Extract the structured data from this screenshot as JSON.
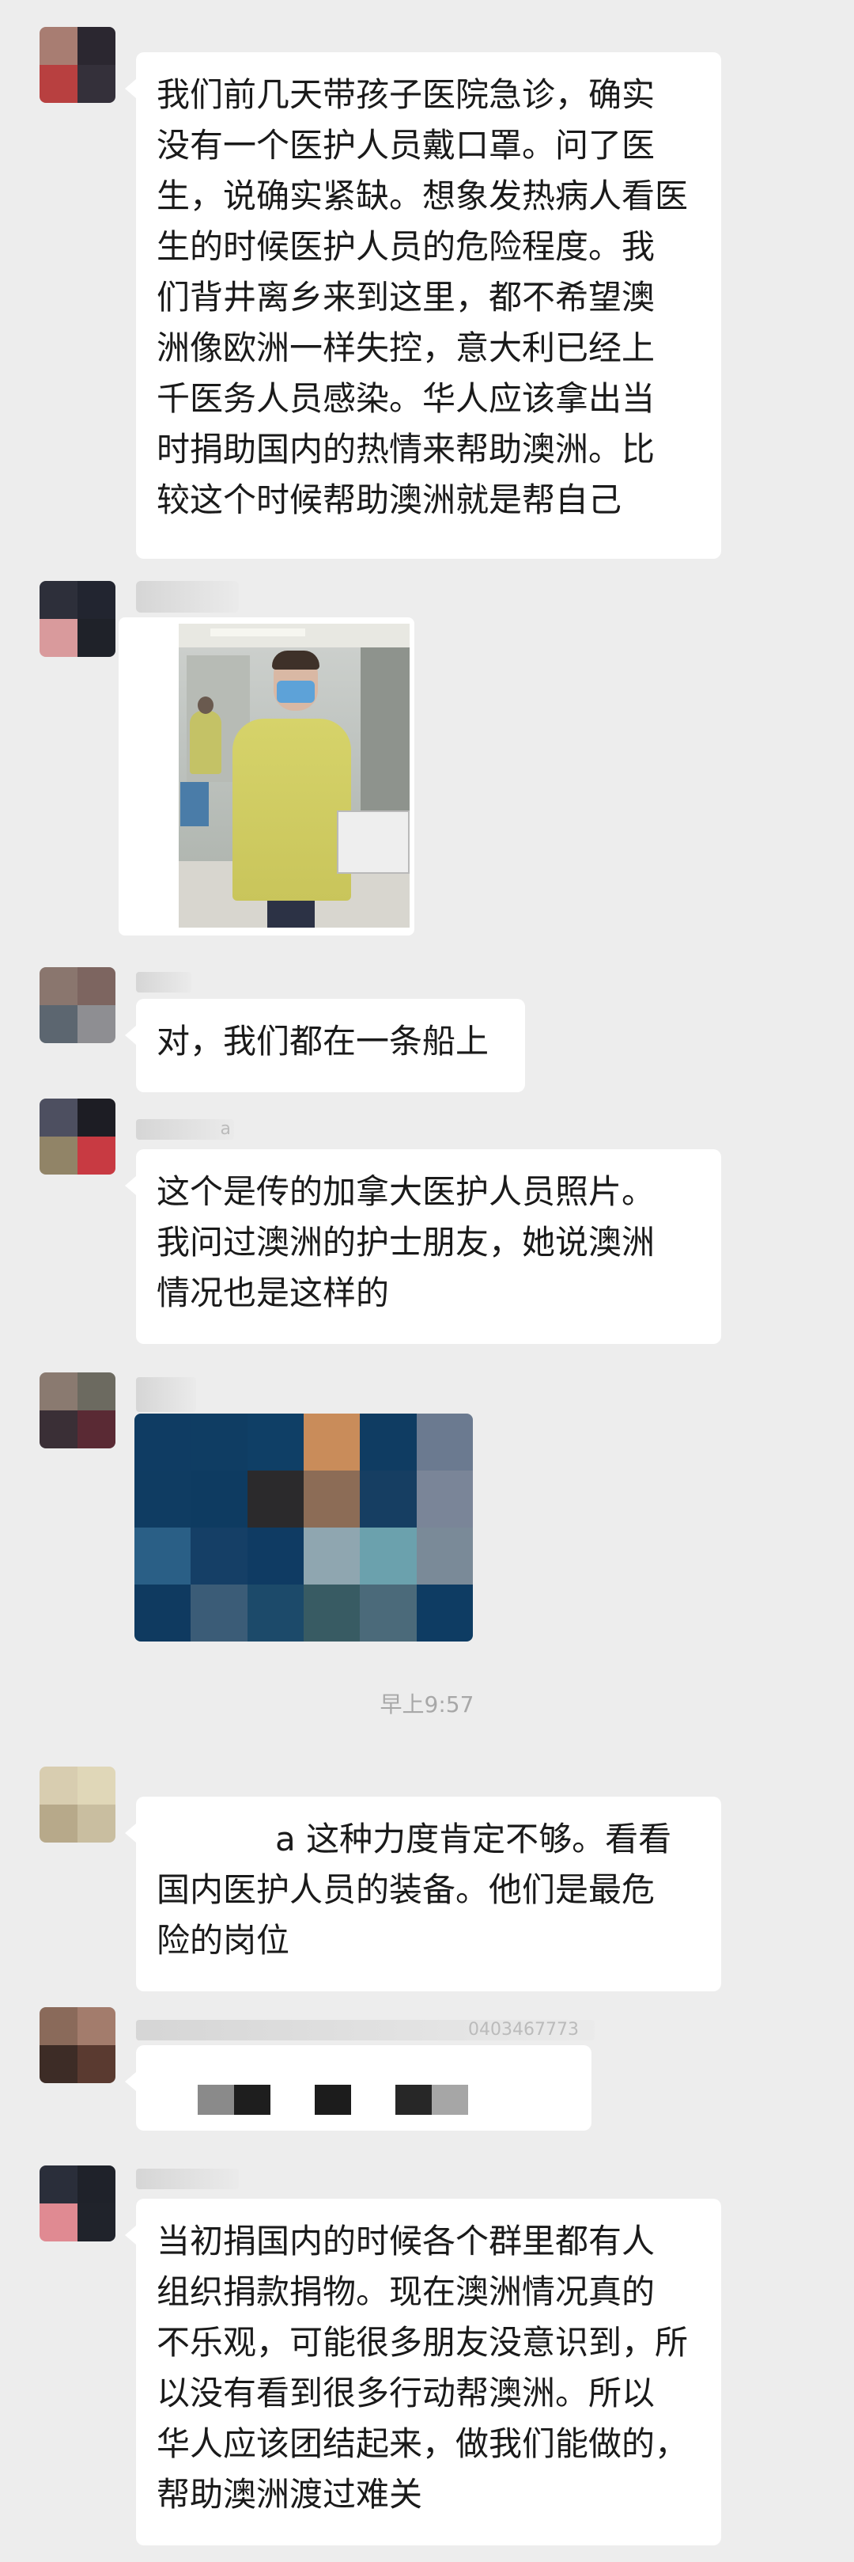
{
  "messages": [
    {
      "lines": [
        "我们前几天带孩子医院急诊，确实",
        "没有一个医护人员戴口罩。问了医",
        "生，说确实紧缺。想象发热病人看医",
        "生的时候医护人员的危险程度。我",
        "们背井离乡来到这里，都不希望澳",
        "洲像欧洲一样失控，意大利已经上",
        "千医务人员感染。华人应该拿出当",
        "时捐助国内的热情来帮助澳洲。比",
        "较这个时候帮助澳洲就是帮自己"
      ]
    },
    {
      "lines": [
        "对，我们都在一条船上"
      ]
    },
    {
      "lines": [
        "这个是传的加拿大医护人员照片。",
        "我问过澳洲的护士朋友，她说澳洲",
        "情况也是这样的"
      ]
    },
    {
      "lines": [
        "a 这种力度肯定不够。看看",
        "国内医护人员的装备。他们是最危",
        "险的岗位"
      ]
    },
    {
      "lines": [
        "当初捐国内的时候各个群里都有人",
        "组织捐款捐物。现在澳洲情况真的",
        "不乐观，可能很多朋友没意识到，所",
        "以没有看到很多行动帮澳洲。所以",
        "华人应该团结起来，做我们能做的，",
        "帮助澳洲渡过难关"
      ]
    }
  ],
  "names": {
    "n3": "a",
    "n7": "0403467773"
  },
  "timestamp": "早上9:57",
  "colors": {
    "background": "#ededed",
    "bubble": "#ffffff",
    "text": "#1a1a1a",
    "time": "#a8a8a8"
  }
}
